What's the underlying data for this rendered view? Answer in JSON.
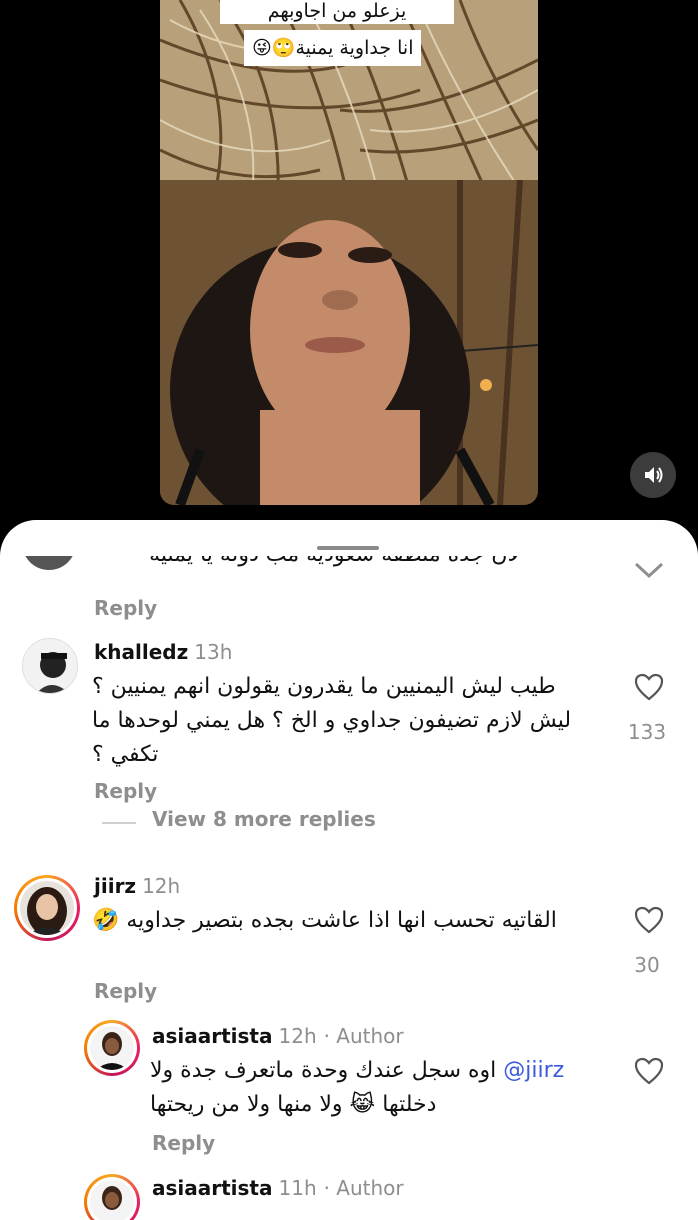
{
  "video": {
    "caption_top": "يزعلو من اجاوبهم",
    "caption_main": "انا جداوية يمنية🙄😜"
  },
  "sheet": {
    "clipped_comment": "لان جده منطقة سعودية مب دولة يا يمنية",
    "reply_label": "Reply"
  },
  "comments": [
    {
      "username": "khalledz",
      "time": "13h",
      "text": "طيب ليش اليمنيين ما يقدرون يقولون انهم يمنيين ؟ ليش لازم تضيفون جداوي و الخ ؟ هل يمني لوحدها ما تكفي ؟",
      "likes": "133",
      "reply": "Reply",
      "view_more": "View 8 more replies"
    },
    {
      "username": "jiirz",
      "time": "12h",
      "text": "القاتيه تحسب انها اذا عاشت بجده بتصير جداويه 🤣",
      "likes": "30",
      "reply": "Reply"
    },
    {
      "username": "asiaartista",
      "time": "12h",
      "author_tag": "· Author",
      "mention": "@jiirz",
      "text": "اوه سجل عندك وحدة ماتعرف جدة ولا دخلتها 😹 ولا منها ولا من ريحتها",
      "reply": "Reply"
    },
    {
      "username": "asiaartista",
      "time": "11h",
      "author_tag": "· Author"
    }
  ],
  "icons": {
    "mute": "speaker-icon",
    "collapse": "chevron-down-icon",
    "like": "heart-outline-icon"
  },
  "colors": {
    "mention": "#3b5bdb",
    "muted_text": "#8e8e8e"
  }
}
